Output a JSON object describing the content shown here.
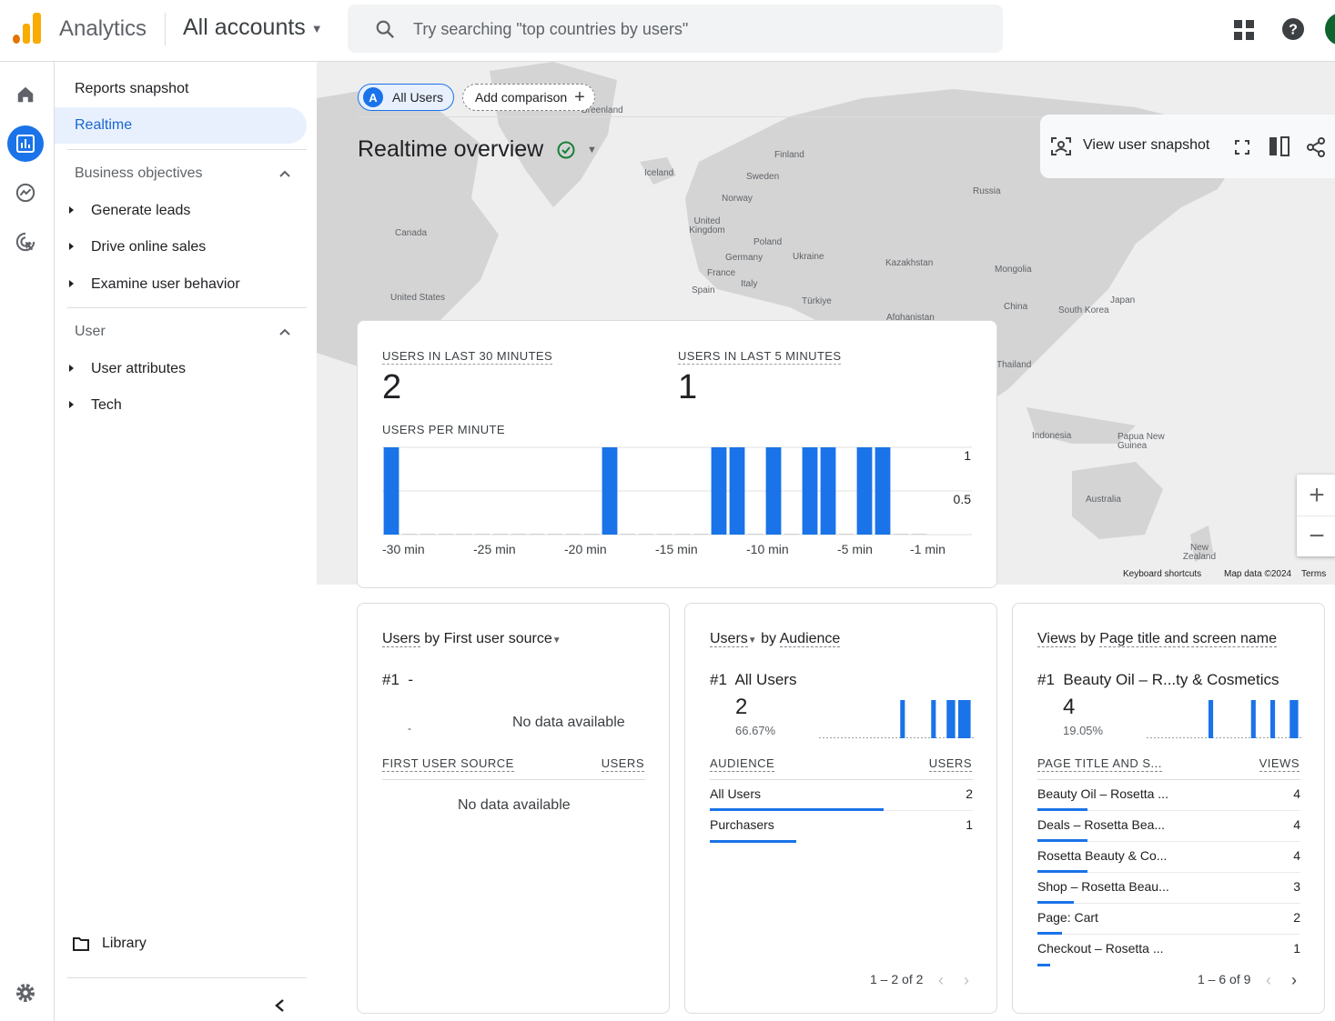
{
  "header": {
    "app_title": "Analytics",
    "account_selector": "All accounts",
    "search_placeholder": "Try searching \"top countries by users\""
  },
  "nav": {
    "reports_snapshot": "Reports snapshot",
    "realtime": "Realtime",
    "business_objectives": "Business objectives",
    "business_items": [
      "Generate leads",
      "Drive online sales",
      "Examine user behavior"
    ],
    "user_section": "User",
    "user_items": [
      "User attributes",
      "Tech"
    ],
    "library": "Library"
  },
  "toolbar": {
    "all_users_badge": "A",
    "all_users": "All Users",
    "add_comparison": "Add comparison",
    "page_title": "Realtime overview",
    "view_user_snapshot": "View user snapshot"
  },
  "map": {
    "labels": [
      "Greenland",
      "Iceland",
      "Finland",
      "Sweden",
      "Norway",
      "Russia",
      "United Kingdom",
      "Poland",
      "Germany",
      "Ukraine",
      "Kazakhstan",
      "Mongolia",
      "France",
      "Italy",
      "Spain",
      "Türkiye",
      "China",
      "Japan",
      "South Korea",
      "Afghanistan",
      "Canada",
      "United States",
      "Thailand",
      "Indonesia",
      "Papua New Guinea",
      "Australia",
      "New Zealand"
    ],
    "keyboard_shortcuts": "Keyboard shortcuts",
    "map_data": "Map data ©2024",
    "terms": "Terms"
  },
  "realtime_card": {
    "users_30_label": "USERS IN LAST 30 MINUTES",
    "users_30_value": "2",
    "users_5_label": "USERS IN LAST 5 MINUTES",
    "users_5_value": "1",
    "per_minute_label": "USERS PER MINUTE"
  },
  "chart_data": {
    "type": "bar",
    "title": "USERS PER MINUTE",
    "x_tick_labels": [
      "-30 min",
      "-25 min",
      "-20 min",
      "-15 min",
      "-10 min",
      "-5 min",
      "-1 min"
    ],
    "y_tick_labels": [
      "1",
      "0.5"
    ],
    "ylim": [
      0,
      1
    ],
    "minutes_ago": [
      30,
      29,
      28,
      27,
      26,
      25,
      24,
      23,
      22,
      21,
      20,
      19,
      18,
      17,
      16,
      15,
      14,
      13,
      12,
      11,
      10,
      9,
      8,
      7,
      6,
      5,
      4,
      3,
      2,
      1
    ],
    "values": [
      1,
      0,
      0,
      0,
      0,
      0,
      0,
      0,
      0,
      0,
      0,
      0,
      1,
      0,
      0,
      0,
      0,
      0,
      1,
      1,
      0,
      1,
      0,
      1,
      1,
      0,
      1,
      1,
      0,
      0
    ],
    "grid": true,
    "legend": "none"
  },
  "source_card": {
    "title_metric": "Users",
    "title_by": "by",
    "title_dim": "First user source",
    "rank": "#1",
    "rank_value": "-",
    "dash": "-",
    "no_data_top": "No data available",
    "col_dim": "FIRST USER SOURCE",
    "col_metric": "USERS",
    "no_data_table": "No data available"
  },
  "audience_card": {
    "title_metric": "Users",
    "title_by": "by",
    "title_dim": "Audience",
    "rank": "#1",
    "rank_value": "All Users",
    "big_value": "2",
    "percent": "66.67%",
    "spark": [
      0,
      0,
      0,
      0,
      0,
      0,
      0,
      0,
      0,
      0,
      0,
      0,
      0,
      0,
      0,
      0,
      0,
      0,
      0,
      0,
      0,
      1,
      0,
      0,
      0,
      0,
      0,
      0,
      0,
      1,
      0,
      0,
      0,
      1,
      1,
      0,
      1,
      1,
      1,
      0
    ],
    "col_dim": "AUDIENCE",
    "col_metric": "USERS",
    "rows": [
      {
        "label": "All Users",
        "value": "2",
        "share": 0.66
      },
      {
        "label": "Purchasers",
        "value": "1",
        "share": 0.33
      }
    ],
    "pager": "1 – 2 of 2"
  },
  "views_card": {
    "title_metric": "Views",
    "title_by": "by",
    "title_dim": "Page title and screen name",
    "rank": "#1",
    "rank_value": "Beauty Oil – R...ty & Cosmetics",
    "big_value": "4",
    "percent": "19.05%",
    "spark": [
      0,
      0,
      0,
      0,
      0,
      0,
      0,
      0,
      0,
      0,
      0,
      0,
      0,
      0,
      0,
      0,
      1,
      0,
      0,
      0,
      0,
      0,
      0,
      0,
      0,
      0,
      0,
      1,
      0,
      0,
      0,
      0,
      1,
      0,
      0,
      0,
      0,
      1,
      1,
      0
    ],
    "col_dim": "PAGE TITLE AND S...",
    "col_metric": "VIEWS",
    "rows": [
      {
        "label": "Beauty Oil – Rosetta ...",
        "value": "4",
        "share": 0.19
      },
      {
        "label": "Deals – Rosetta Bea...",
        "value": "4",
        "share": 0.19
      },
      {
        "label": "Rosetta Beauty & Co...",
        "value": "4",
        "share": 0.19
      },
      {
        "label": "Shop – Rosetta Beau...",
        "value": "3",
        "share": 0.14
      },
      {
        "label": "Page: Cart",
        "value": "2",
        "share": 0.095
      },
      {
        "label": "Checkout – Rosetta ...",
        "value": "1",
        "share": 0.048
      }
    ],
    "pager": "1 – 6 of 9"
  },
  "colors": {
    "accent": "#1a73e8",
    "logo_orange": "#f9ab00",
    "logo_dark_orange": "#e37400",
    "check_green": "#188038",
    "map_land": "#d4d4d4",
    "map_water": "#eeeeee"
  }
}
